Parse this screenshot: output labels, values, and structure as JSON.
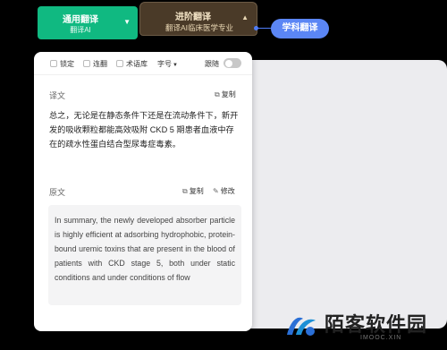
{
  "modes": {
    "general": {
      "title": "通用翻译",
      "subtitle": "翻译AI",
      "caret": "▼"
    },
    "advanced": {
      "title": "进阶翻译",
      "subtitle": "翻译AI临床医学专业",
      "caret": "▲"
    },
    "subject_label": "学科翻译"
  },
  "toolbar": {
    "lock_label": "锁定",
    "connect_label": "连翻",
    "terms_label": "术语库",
    "font_label": "字号",
    "follow_label": "跟随",
    "follow_enabled": false
  },
  "translation": {
    "label": "译文",
    "copy_label": "复制",
    "text": "总之，无论是在静态条件下还是在流动条件下，新开发的吸收颗粒都能高效吸附 CKD 5 期患者血液中存在的疏水性蛋白结合型尿毒症毒素。"
  },
  "source": {
    "label": "原文",
    "copy_label": "复制",
    "edit_label": "修改",
    "text": "In summary, the newly developed absorber particle is highly efficient at adsorbing hydrophobic, protein-bound uremic toxins that are present in the blood of patients with CKD stage 5, both under static conditions and under conditions of flow"
  },
  "watermark": {
    "name": "陌客软件园",
    "domain": "IMOOC.XIN"
  },
  "colors": {
    "general_green": "#10b981",
    "advanced_brown": "#4a3a28",
    "subject_blue": "#5b86f5"
  }
}
